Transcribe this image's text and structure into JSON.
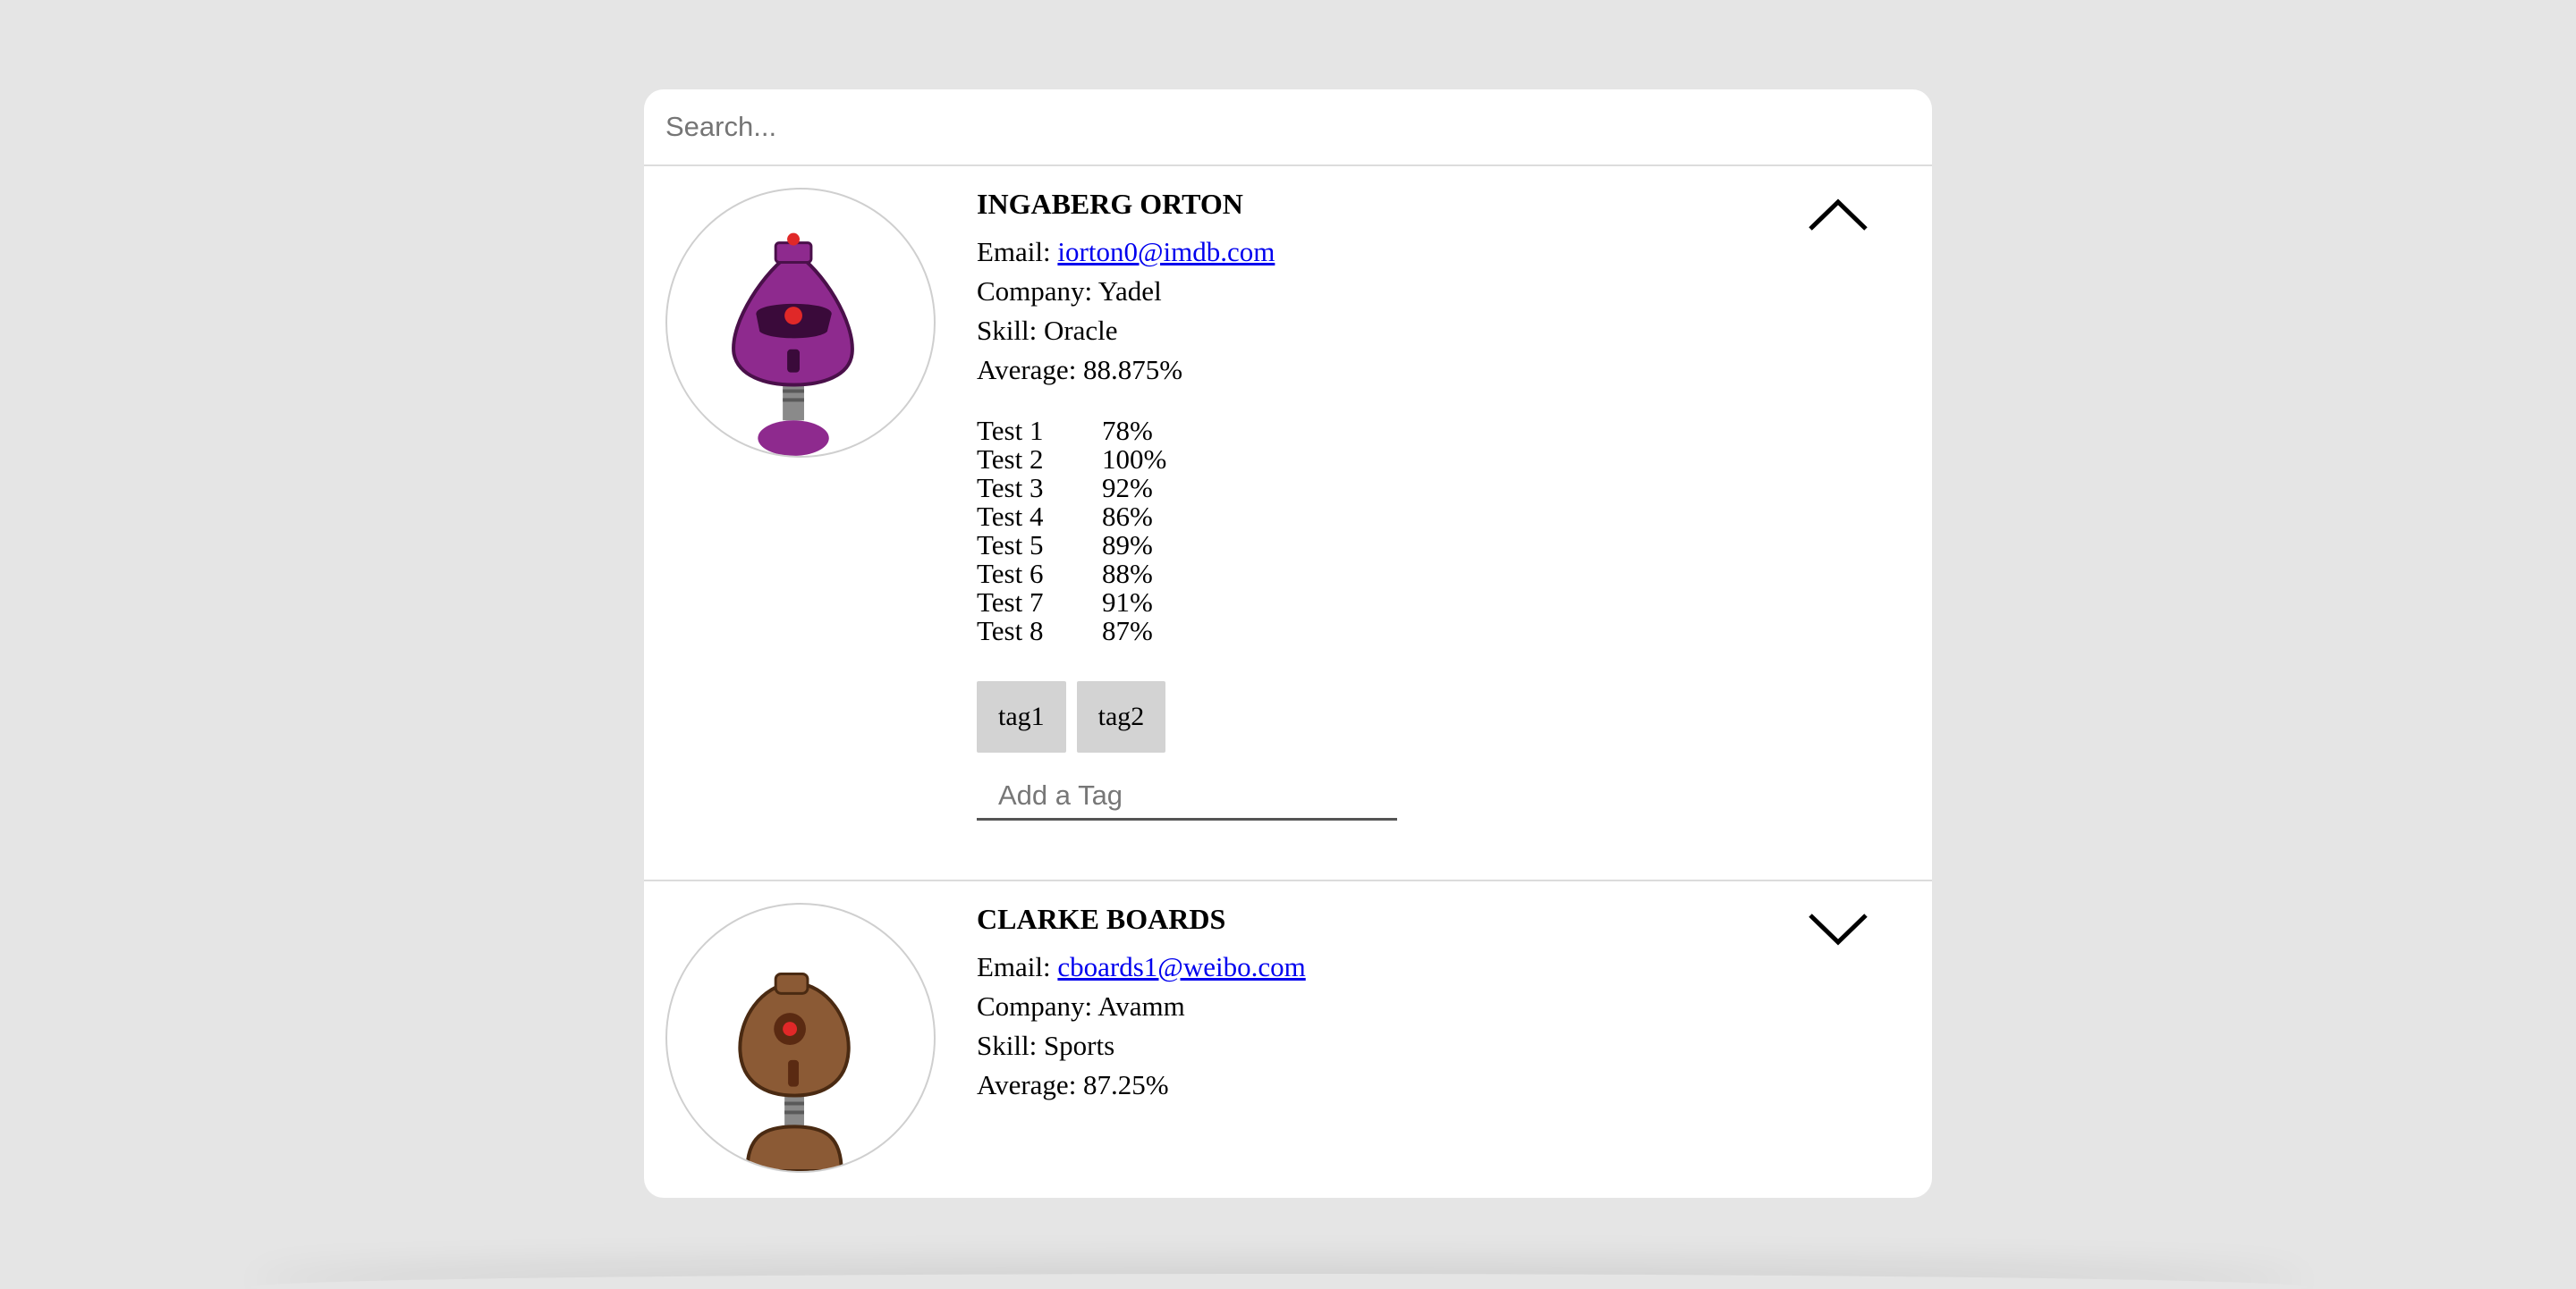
{
  "search": {
    "placeholder": "Search..."
  },
  "students": [
    {
      "name": "INGABERG ORTON",
      "email_label": "Email: ",
      "email": "iorton0@imdb.com",
      "company": "Company: Yadel",
      "skill": "Skill: Oracle",
      "average": "Average: 88.875%",
      "avatar_color": "#8e2a8e",
      "expanded": true,
      "grades": [
        {
          "label": "Test 1",
          "value": "78%"
        },
        {
          "label": "Test 2",
          "value": "100%"
        },
        {
          "label": "Test 3",
          "value": "92%"
        },
        {
          "label": "Test 4",
          "value": "86%"
        },
        {
          "label": "Test 5",
          "value": "89%"
        },
        {
          "label": "Test 6",
          "value": "88%"
        },
        {
          "label": "Test 7",
          "value": "91%"
        },
        {
          "label": "Test 8",
          "value": "87%"
        }
      ],
      "tags": [
        "tag1",
        "tag2"
      ],
      "add_tag_placeholder": "Add a Tag",
      "toggle_icon": "chevron-up-icon"
    },
    {
      "name": "CLARKE BOARDS",
      "email_label": "Email: ",
      "email": "cboards1@weibo.com",
      "company": "Company: Avamm",
      "skill": "Skill: Sports",
      "average": "Average: 87.25%",
      "avatar_color": "#8b5a35",
      "expanded": false,
      "toggle_icon": "chevron-down-icon"
    }
  ]
}
